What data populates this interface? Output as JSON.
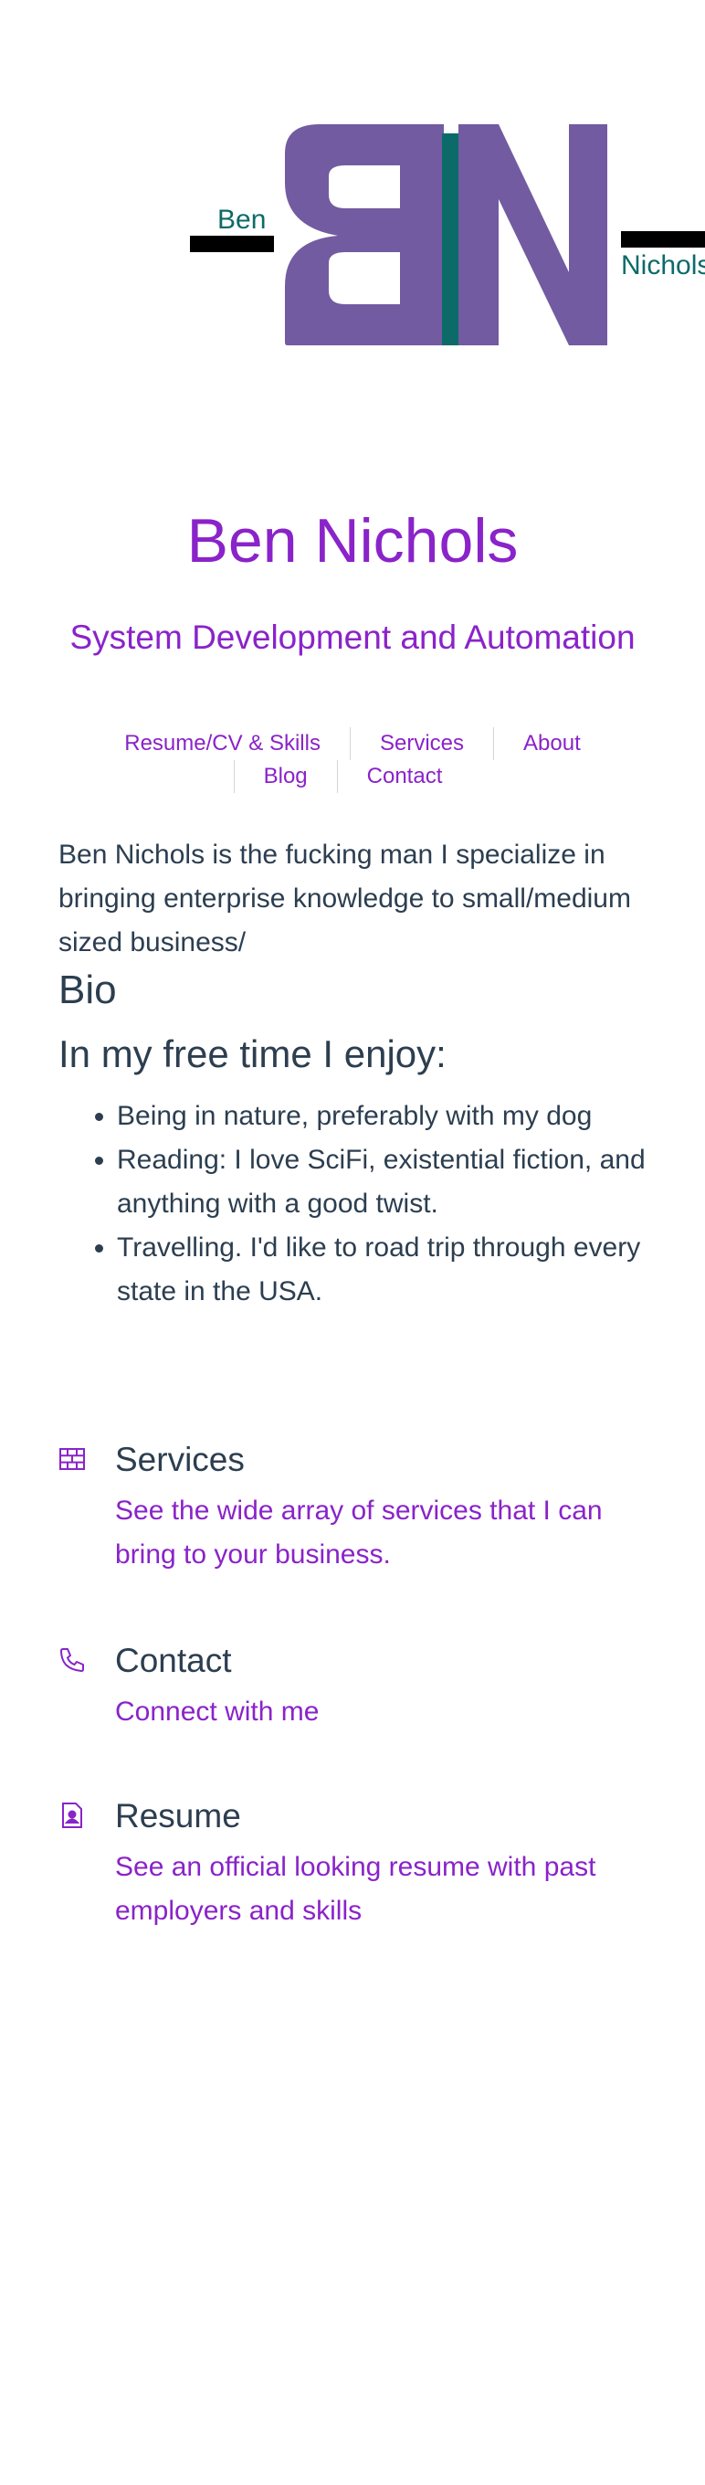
{
  "logo": {
    "first_name": "Ben",
    "last_name": "Nichols",
    "colors": {
      "purple": "#725ba1",
      "teal": "#0c6b68",
      "black": "#000000"
    }
  },
  "hero": {
    "title": "Ben Nichols",
    "subtitle": "System Development and Automation"
  },
  "nav": {
    "row1": [
      "Resume/CV & Skills",
      "Services",
      "About"
    ],
    "row2": [
      "Blog",
      "Contact"
    ]
  },
  "intro": "Ben Nichols is the fucking man I specialize in bringing enterprise knowledge to small/medium sized business/",
  "bio_heading": "Bio",
  "free_time_heading": "In my free time I enjoy:",
  "enjoy": [
    "Being in nature, preferably with my dog",
    "Reading: I love SciFi, existential fiction, and anything with a good twist.",
    "Travelling. I'd like to road trip through every state in the USA."
  ],
  "features": {
    "services": {
      "icon": "brick-wall-icon",
      "title": "Services",
      "text": "See the wide array of services that I can bring to your business."
    },
    "contact": {
      "icon": "phone-icon",
      "title": "Contact",
      "text": "Connect with me"
    },
    "resume": {
      "icon": "resume-document-icon",
      "title": "Resume",
      "text": "See an official looking resume with past employers and skills"
    }
  },
  "accent_color": "#8a23c9",
  "text_color": "#2c3e50"
}
